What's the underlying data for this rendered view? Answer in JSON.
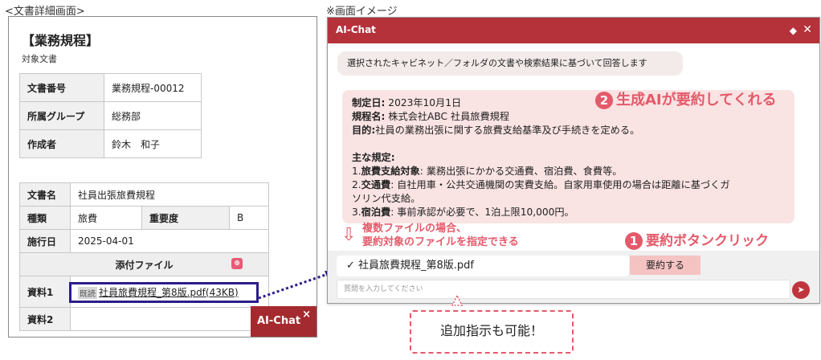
{
  "captions": {
    "left": "<文書詳細画面>",
    "right": "※画面イメージ"
  },
  "document": {
    "title": "【業務規程】",
    "subtitle": "対象文書",
    "meta": [
      {
        "label": "文書番号",
        "value": "業務規程-00012"
      },
      {
        "label": "所属グループ",
        "value": "総務部"
      },
      {
        "label": "作成者",
        "value": "鈴木　和子"
      }
    ],
    "doc_name_label": "文書名",
    "doc_name_value": "社員出張旅費規程",
    "type_label": "種類",
    "type_value": "旅費",
    "importance_label": "重要度",
    "importance_value": "B",
    "date_label": "施行日",
    "date_value": "2025-04-01",
    "attach_header": "添付ファイル",
    "attach1_label": "資料1",
    "attach1_badge": "既読",
    "attach1_file": "社員旅費規程_第8版.pdf(43KB)",
    "attach2_label": "資料2"
  },
  "aichat_tab": {
    "label": "AI-Chat",
    "close": "×"
  },
  "chat": {
    "title": "AI-Chat",
    "system_message": "選択されたキャビネット／フォルダの文書や検索結果に基づいて回答します",
    "answer": {
      "l1_key": "制定日:",
      "l1_val": " 2023年10月1日",
      "l2_key": "規程名:",
      "l2_val": " 株式会社ABC 社員旅費規程",
      "l3_key": "目的:",
      "l3_val": "社員の業務出張に関する旅費支給基準及び手続きを定める。",
      "l4": "主な規定:",
      "l5_num": "1.",
      "l5_key": "旅費支給対象",
      "l5_val": ": 業務出張にかかる交通費、宿泊費、食費等。",
      "l6_num": "2.",
      "l6_key": "交通費",
      "l6_val": ": 自社用車・公共交通機関の実費支給。自家用車使用の場合は距離に基づくガ",
      "l7": "ソリン代支給。",
      "l8_num": "3.",
      "l8_key": "宿泊費",
      "l8_val": ": 事前承認が必要で、1泊上限10,000円。"
    },
    "file_selected": "✓ 社員旅費規程_第8版.pdf",
    "summarize_button": "要約する",
    "input_placeholder": "質問を入力してください"
  },
  "annotations": {
    "a2_num": "2",
    "a2_text": "生成AIが要約してくれる",
    "a1_num": "1",
    "a1_text": "要約ボタンクリック",
    "multi_line1": "複数ファイルの場合、",
    "multi_line2": "要約対象のファイルを指定できる",
    "hint": "追加指示も可能！"
  },
  "colors": {
    "header": "#b5323a",
    "accent": "#e45a6a",
    "highlight": "#2b1d8a"
  }
}
